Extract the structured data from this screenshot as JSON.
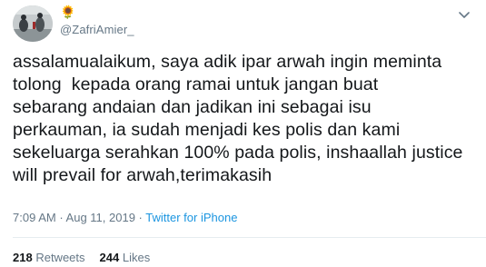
{
  "user": {
    "display_name_icon": "sunflower-icon",
    "display_name_glyph": "🌻",
    "handle": "@ZafriAmier_"
  },
  "tweet": {
    "text": "assalamualaikum, saya adik ipar arwah ingin meminta\ntolong  kepada orang ramai untuk jangan buat\nsebarang andaian dan jadikan ini sebagai isu\nperkauman, ia sudah menjadi kes polis dan kami\nsekeluarga serahkan 100% pada polis, inshaallah justice\nwill prevail for arwah,terimakasih",
    "time": "7:09 AM",
    "separator": " · ",
    "date": "Aug 11, 2019",
    "source": "Twitter for iPhone"
  },
  "stats": {
    "retweets_count": "218",
    "retweets_label": "Retweets",
    "likes_count": "244",
    "likes_label": "Likes"
  },
  "colors": {
    "text": "#14171a",
    "muted": "#657786",
    "link": "#1b95e0",
    "divider": "#e6ecf0"
  }
}
